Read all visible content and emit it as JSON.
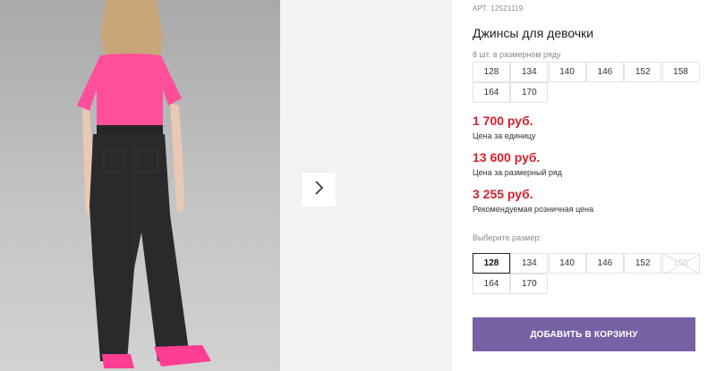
{
  "product": {
    "article_label": "АРТ.",
    "article": "12521119",
    "title": "Джинсы для девочки"
  },
  "size_row": {
    "label": "8 шт. в размерном ряду",
    "sizes": [
      "128",
      "134",
      "140",
      "146",
      "152",
      "158",
      "164",
      "170"
    ]
  },
  "prices": [
    {
      "value": "1 700 руб.",
      "note": "Цена за единицу"
    },
    {
      "value": "13 600 руб.",
      "note": "Цена за размерный ряд"
    },
    {
      "value": "3 255 руб.",
      "note": "Рекомендуемая розничная цена"
    }
  ],
  "size_select": {
    "label": "Выберите размер:",
    "options": [
      {
        "size": "128",
        "state": "selected"
      },
      {
        "size": "134",
        "state": "available"
      },
      {
        "size": "140",
        "state": "available"
      },
      {
        "size": "146",
        "state": "available"
      },
      {
        "size": "152",
        "state": "available"
      },
      {
        "size": "158",
        "state": "unavailable"
      },
      {
        "size": "164",
        "state": "available"
      },
      {
        "size": "170",
        "state": "available"
      }
    ]
  },
  "cart_button": {
    "label": "ДОБАВИТЬ В КОРЗИНУ"
  },
  "gallery": {
    "next_icon": "chevron-right-icon"
  },
  "colors": {
    "price": "#d2222d",
    "cart_button": "#7761a5",
    "tshirt": "#ff4f9b",
    "jeans": "#2a2a2c"
  }
}
